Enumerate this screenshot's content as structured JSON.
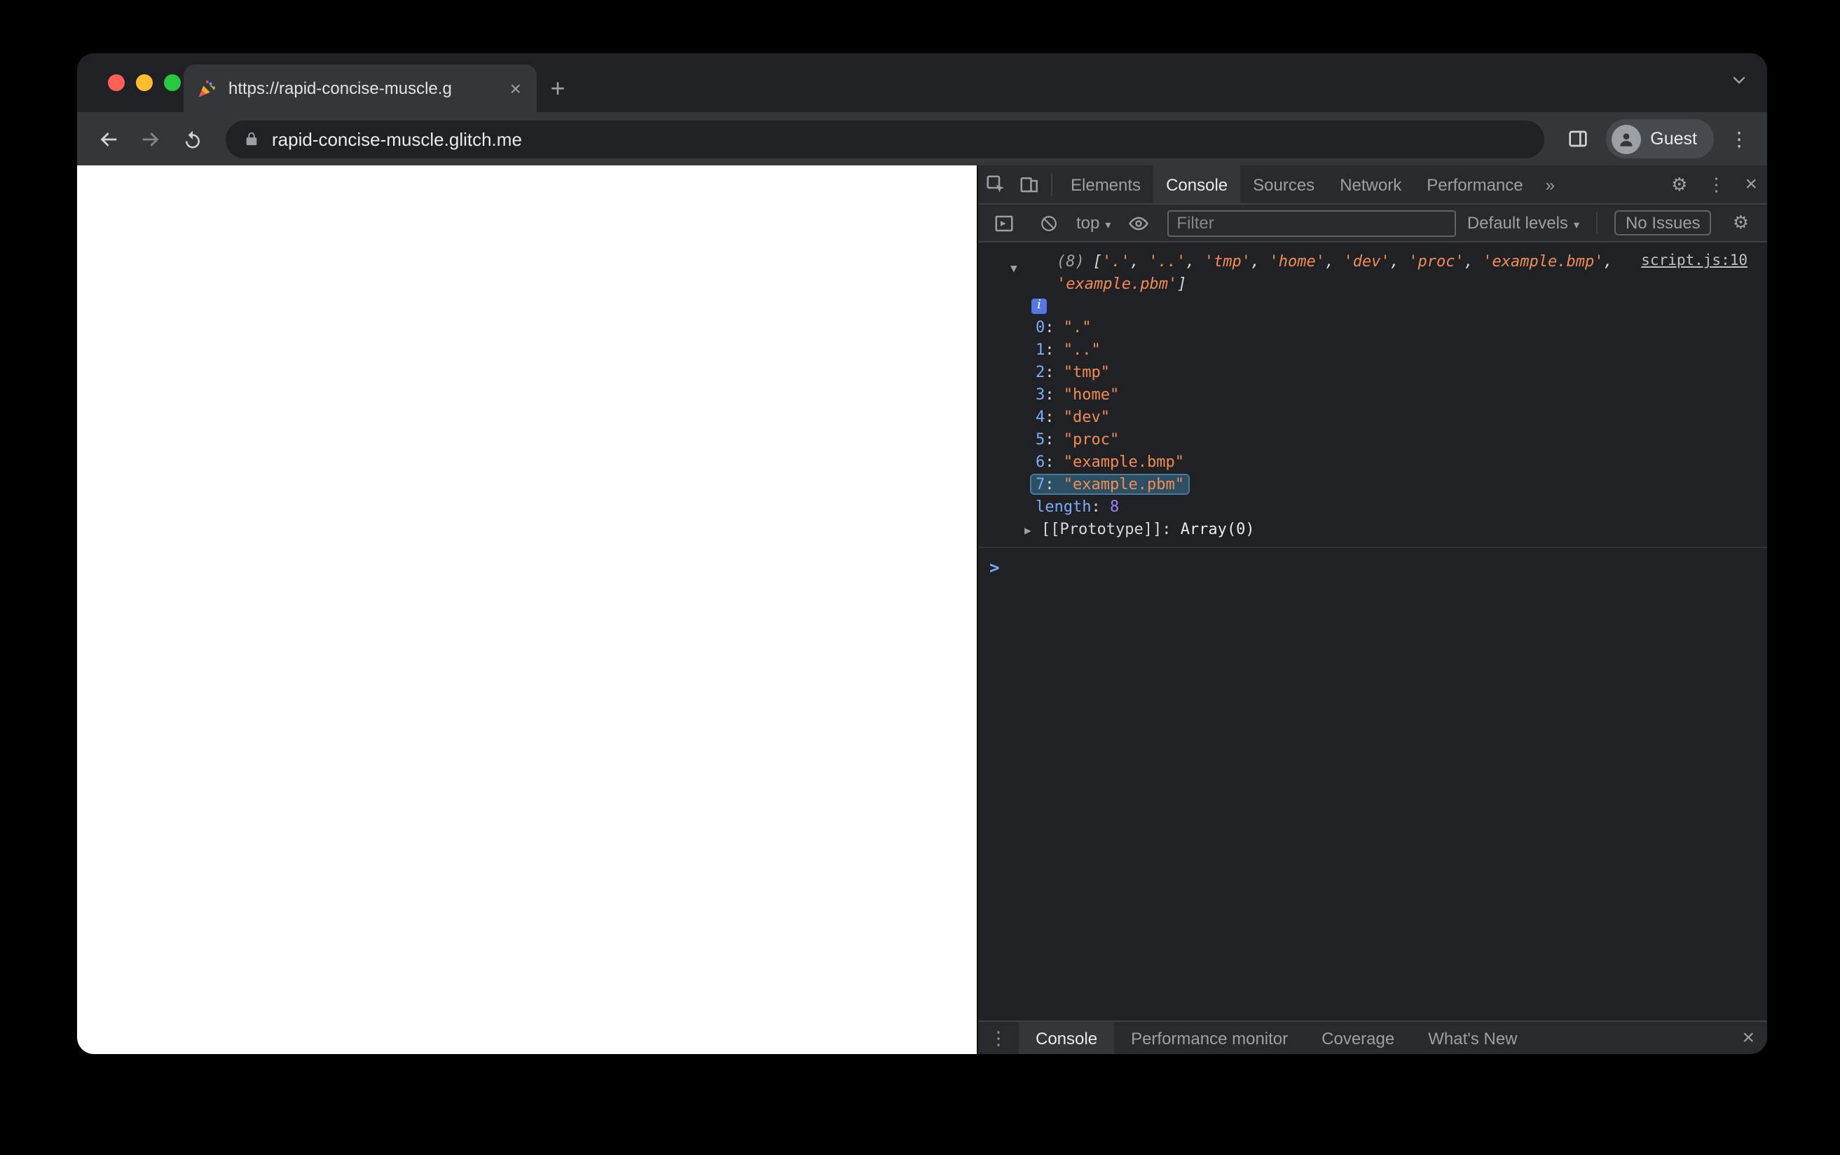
{
  "window": {
    "traffic_lights": [
      "#ff5f57",
      "#febc2e",
      "#28c840"
    ]
  },
  "browser": {
    "tab": {
      "favicon": "party-popper",
      "title": "https://rapid-concise-muscle.g",
      "close_glyph": "×"
    },
    "new_tab_glyph": "+",
    "toolbar": {
      "url": "rapid-concise-muscle.glitch.me",
      "profile_label": "Guest",
      "menu_glyph": "⋮"
    }
  },
  "devtools": {
    "main_tabs": [
      "Elements",
      "Console",
      "Sources",
      "Network",
      "Performance"
    ],
    "active_main_tab": "Console",
    "more_tabs_glyph": "»",
    "toolbar_right": {
      "settings_glyph": "⚙",
      "menu_glyph": "⋮",
      "close_glyph": "×"
    },
    "sub_toolbar": {
      "context_label": "top",
      "caret_glyph": "▾",
      "filter_placeholder": "Filter",
      "levels_label": "Default levels",
      "issues_label": "No Issues"
    },
    "console": {
      "source_link": "script.js:10",
      "count_prefix": "(8)",
      "files": [
        ".",
        "..",
        "tmp",
        "home",
        "dev",
        "proc",
        "example.bmp",
        "example.pbm"
      ],
      "highlighted_index": 7,
      "info_badge": "i",
      "length_label": "length",
      "length_value": "8",
      "prototype_label": "[[Prototype]]",
      "prototype_value": "Array(0)",
      "separator": ": ",
      "comma": ", ",
      "bracket_open": "[",
      "bracket_close": "]",
      "expanded_glyph": "▼",
      "collapsed_glyph": "▶",
      "prompt_glyph": ">"
    },
    "drawer": {
      "tabs": [
        "Console",
        "Performance monitor",
        "Coverage",
        "What's New"
      ],
      "active_tab": "Console",
      "menu_glyph": "⋮",
      "close_glyph": "×"
    }
  },
  "colors": {
    "string": "#f28b54",
    "key": "#7cacf8",
    "number": "#9980ff",
    "highlight": "#2d4f63",
    "devtools_bg": "#202124",
    "toolbar_bg": "#292a2d",
    "browser_toolbar_bg": "#35363a"
  }
}
